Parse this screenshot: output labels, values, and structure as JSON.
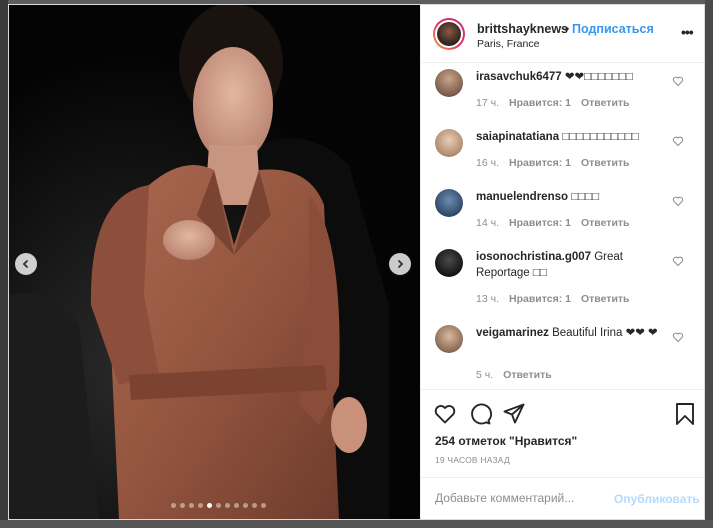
{
  "post": {
    "username": "brittshayknews",
    "separator": "•",
    "follow_label": "Подписаться",
    "location": "Paris, France",
    "more_label": "•••"
  },
  "carousel": {
    "slide_count": 11,
    "active_slide": 4
  },
  "comments": [
    {
      "user": "irasavchuk6477",
      "text": "❤❤□□□□□□□",
      "time": "17 ч.",
      "likes": "Нравится: 1",
      "reply": "Ответить"
    },
    {
      "user": "saiapinatatiana",
      "text": "□□□□□□□□□□□",
      "time": "16 ч.",
      "likes": "Нравится: 1",
      "reply": "Ответить"
    },
    {
      "user": "manuelendrenso",
      "text": "□□□□",
      "time": "14 ч.",
      "likes": "Нравится: 1",
      "reply": "Ответить"
    },
    {
      "user": "iosonochristina.g007",
      "text": "Great Reportage □□",
      "time": "13 ч.",
      "likes": "Нравится: 1",
      "reply": "Ответить"
    },
    {
      "user": "veigamarinez",
      "text": "Beautiful Irina ❤❤ ❤",
      "time": "5 ч.",
      "likes": "",
      "reply": "Ответить"
    }
  ],
  "likes_count": "254 отметок \"Нравится\"",
  "time_ago": "19 ЧАСОВ НАЗАД",
  "add_comment": {
    "placeholder": "Добавьте комментарий...",
    "publish_label": "Опубликовать"
  },
  "colors": {
    "accent": "#3897f0",
    "publish_disabled": "#b3dbff",
    "meta": "#8e8e8e"
  }
}
